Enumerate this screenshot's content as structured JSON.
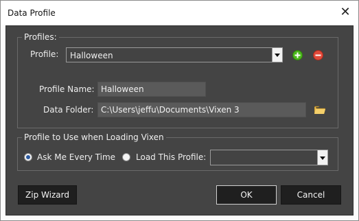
{
  "window": {
    "title": "Data Profile",
    "close_glyph": "✕"
  },
  "profiles_group": {
    "legend": "Profiles:",
    "profile_label": "Profile:",
    "profile_selected": "Halloween",
    "add_icon": "plus-icon",
    "remove_icon": "minus-icon",
    "profile_name_label": "Profile Name:",
    "profile_name_value": "Halloween",
    "data_folder_label": "Data Folder:",
    "data_folder_value": "C:\\Users\\jeffu\\Documents\\Vixen 3",
    "browse_icon": "folder-icon"
  },
  "load_group": {
    "legend": "Profile to Use when Loading Vixen",
    "ask_label": "Ask Me Every Time",
    "ask_checked": true,
    "load_label": "Load This Profile:",
    "load_checked": false,
    "load_profile_selected": ""
  },
  "buttons": {
    "zip_wizard": "Zip Wizard",
    "ok": "OK",
    "cancel": "Cancel"
  },
  "colors": {
    "client_bg": "#444444",
    "add": "#4cb81c",
    "remove": "#e24a3a",
    "folder": "#e8b84a"
  }
}
